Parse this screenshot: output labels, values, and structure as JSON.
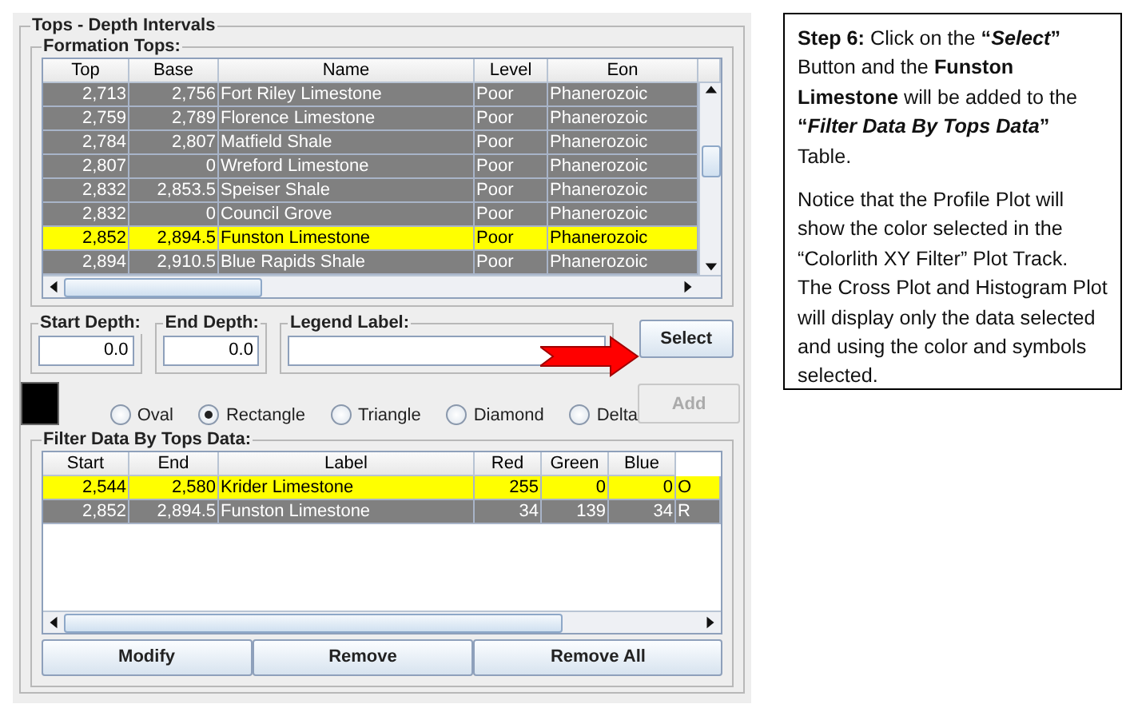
{
  "panel": {
    "title": "Tops - Depth Intervals"
  },
  "formation_tops": {
    "title": "Formation Tops:",
    "columns": [
      "Top",
      "Base",
      "Name",
      "Level",
      "Eon"
    ],
    "rows": [
      {
        "cells": [
          "2,713",
          "2,756",
          "Fort Riley Limestone",
          "Poor",
          "Phanerozoic"
        ],
        "selected": false
      },
      {
        "cells": [
          "2,759",
          "2,789",
          "Florence Limestone",
          "Poor",
          "Phanerozoic"
        ],
        "selected": false
      },
      {
        "cells": [
          "2,784",
          "2,807",
          "Matfield Shale",
          "Poor",
          "Phanerozoic"
        ],
        "selected": false
      },
      {
        "cells": [
          "2,807",
          "0",
          "Wreford Limestone",
          "Poor",
          "Phanerozoic"
        ],
        "selected": false
      },
      {
        "cells": [
          "2,832",
          "2,853.5",
          "Speiser Shale",
          "Poor",
          "Phanerozoic"
        ],
        "selected": false
      },
      {
        "cells": [
          "2,832",
          "0",
          "Council Grove",
          "Poor",
          "Phanerozoic"
        ],
        "selected": false
      },
      {
        "cells": [
          "2,852",
          "2,894.5",
          "Funston Limestone",
          "Poor",
          "Phanerozoic"
        ],
        "selected": true
      },
      {
        "cells": [
          "2,894",
          "2,910.5",
          "Blue Rapids Shale",
          "Poor",
          "Phanerozoic"
        ],
        "selected": false
      }
    ]
  },
  "fields": [
    {
      "label": "Start Depth:",
      "value": "0.0"
    },
    {
      "label": "End Depth:",
      "value": "0.0"
    },
    {
      "label": "Legend Label:"
    }
  ],
  "select_button": {
    "label": "Select",
    "disabled": false
  },
  "color_swatch": {
    "color": "#000000"
  },
  "symbols": [
    {
      "label": "Oval",
      "selected": false
    },
    {
      "label": "Rectangle",
      "selected": true
    },
    {
      "label": "Triangle",
      "selected": false
    },
    {
      "label": "Diamond",
      "selected": false
    },
    {
      "label": "Delta",
      "selected": false
    }
  ],
  "add_button": {
    "label": "Add",
    "disabled": true
  },
  "filter_table": {
    "title": "Filter Data By Tops Data:",
    "columns": [
      "Start",
      "End",
      "Label",
      "Red",
      "Green",
      "Blue"
    ],
    "rows": [
      {
        "cells": [
          "2,544",
          "2,580",
          "Krider Limestone",
          "255",
          "0",
          "0",
          "O"
        ],
        "selected": true
      },
      {
        "cells": [
          "2,852",
          "2,894.5",
          "Funston Limestone",
          "34",
          "139",
          "34",
          "R"
        ],
        "selected": false
      }
    ]
  },
  "bottom_buttons": [
    "Modify",
    "Remove",
    "Remove All"
  ],
  "instructions": [
    "**Step 6:** Click on the **“*Select*”** Button and the **Funston Limestone** will be added to the **“*Filter Data By Tops Data*”** Table.",
    "Notice that the Profile Plot will show the color selected in the “Colorlith XY Filter” Plot Track. The Cross Plot and Histogram Plot will display only the data selected and using the color and symbols selected."
  ]
}
